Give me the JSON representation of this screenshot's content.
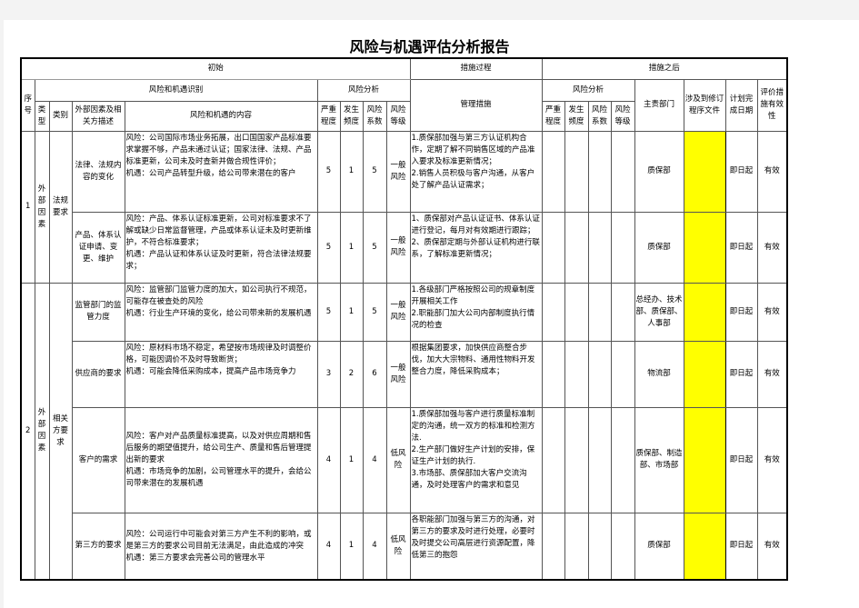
{
  "title": "风险与机遇评估分析报告",
  "header": {
    "initial": "初始",
    "process": "措施过程",
    "after": "措施之后",
    "identify": "风险和机遇识别",
    "risk_analysis": "风险分析",
    "seq": "序号",
    "type": "类型",
    "category": "类别",
    "ext_desc": "外部因素及相关方描述",
    "content": "风险和机遇的内容",
    "severity": "严重程度",
    "frequency": "发生频度",
    "coefficient": "风险系数",
    "level": "风险等级",
    "measures": "管理措施",
    "after_risk_analysis": "风险分析",
    "after_severity": "严重程度",
    "after_frequency": "发生频度",
    "after_coefficient": "风险系数",
    "after_level": "风险等级",
    "dept": "主责部门",
    "docs": "涉及到修订程序文件",
    "plan_date": "计划完成日期",
    "evaluation": "评价措施有效性"
  },
  "groups": [
    {
      "seq": "1",
      "type": "外部因素",
      "category": "法规要求"
    },
    {
      "seq": "2",
      "type": "外部因素",
      "category": "相关方要求"
    }
  ],
  "rows": [
    {
      "ext_desc": "法律、法规内容的变化",
      "content": "风险：公司国际市场业务拓展，出口国国家产品标准要求掌握不够，产品未通过认证；国家法律、法规、产品标准更新，公司未及时查新并做合规性评价；\n机遇：公司产品转型升级，给公司带来潜在的客户",
      "severity": "5",
      "frequency": "1",
      "coefficient": "5",
      "level": "一般风险",
      "measures": "1.质保部加强与第三方认证机构合作，定期了解不同销售区域的产品准入要求及标准更新情况；\n2.销售人员积极与客户沟通，从客户处了解产品认证需求；",
      "dept": "质保部",
      "plan_date": "即日起",
      "evaluation": "有效"
    },
    {
      "ext_desc": "产品、体系认证申请、变更、维护",
      "content": "风险：产品、体系认证标准更新，公司对标准要求不了解或缺少日常监督管理，产品或体系认证未及时更新维护，不符合标准要求；\n机遇：产品认证和体系认证及时更新，符合法律法规要求；",
      "severity": "5",
      "frequency": "1",
      "coefficient": "5",
      "level": "一般风险",
      "measures": "1、质保部对产品认证证书、体系认证进行登记，每月对有效期进行跟踪；\n2、质保部定期与外部认证机构进行联系，了解标准更新情况；",
      "dept": "质保部",
      "plan_date": "即日起",
      "evaluation": "有效"
    },
    {
      "ext_desc": "监管部门的监管力度",
      "content": "风险：监管部门监管力度的加大，如公司执行不规范，可能存在被查处的风险\n机遇：行业生产环境的变化，给公司带来新的发展机遇",
      "severity": "5",
      "frequency": "1",
      "coefficient": "5",
      "level": "一般风险",
      "measures": "1.各级部门严格按照公司的规章制度开展相关工作\n2.职能部门加大公司内部制度执行情况的检查",
      "dept": "总经办、技术部、质保部、人事部",
      "plan_date": "即日起",
      "evaluation": "有效"
    },
    {
      "ext_desc": "供应商的要求",
      "content": "风险：原材料市场不稳定，希望按市场规律及时调整价格，可能因调价不及时导致断货；\n机遇：可能会降低采购成本，提高产品市场竞争力",
      "severity": "3",
      "frequency": "2",
      "coefficient": "6",
      "level": "一般风险",
      "measures": "根据集团要求，加快供应商整合步伐，加大大宗物料、通用性物料开发整合力度，降低采购成本；",
      "dept": "物流部",
      "plan_date": "即日起",
      "evaluation": "有效"
    },
    {
      "ext_desc": "客户的需求",
      "content": "风险：客户对产品质量标准提高，以及对供应周期和售后服务的期望值提升，给公司生产、质量和售后管理提出新的要求\n机遇：市场竞争的加剧，公司管理水平的提升，会给公司带来潜在的发展机遇",
      "severity": "4",
      "frequency": "1",
      "coefficient": "4",
      "level": "低风险",
      "measures": "1.质保部加强与客户进行质量标准制定的沟通，统一双方的标准和检测方法.\n2.生产部门做好生产计划的安排，保证生产计划的执行.\n3.市场部、质保部加大客户交流沟通，及时处理客户的需求和意见",
      "dept": "质保部、制造部、市场部",
      "plan_date": "即日起",
      "evaluation": "有效"
    },
    {
      "ext_desc": "第三方的要求",
      "content": "风险：公司运行中可能会对第三方产生不利的影响，或是第三方的要求公司目前无法满足，由此造成的冲突\n机遇：第三方要求会完善公司的管理水平",
      "severity": "4",
      "frequency": "1",
      "coefficient": "4",
      "level": "低风险",
      "measures": "各职能部门加强与第三方的沟通，对第三方的要求及时进行处理，必要时及时提交公司高层进行资源配置，降低第三的抱怨",
      "dept": "质保部",
      "plan_date": "即日起",
      "evaluation": "有效"
    }
  ],
  "colors": {
    "highlight": "#ffff00",
    "border": "#000000",
    "background": "#f3f3f3"
  }
}
